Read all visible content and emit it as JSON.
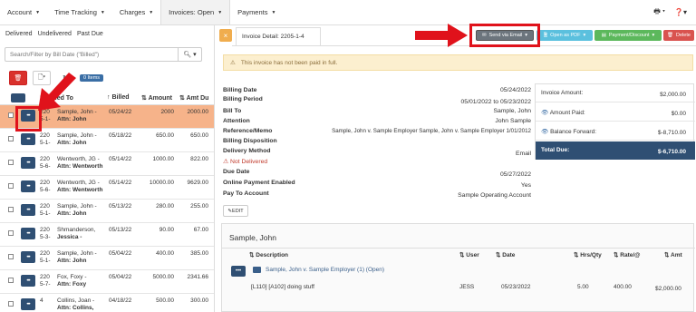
{
  "nav": {
    "items": [
      {
        "label": "Account"
      },
      {
        "label": "Time Tracking"
      },
      {
        "label": "Charges"
      },
      {
        "label": "Invoices: Open"
      },
      {
        "label": "Payments"
      }
    ]
  },
  "filters": {
    "links": [
      "Delivered",
      "Undelivered",
      "Past Due"
    ]
  },
  "search": {
    "placeholder": "Search/Filter by Bill Date (\"Billed\")"
  },
  "toolbar": {
    "items_badge": "0 Items"
  },
  "table": {
    "headers": {
      "bill_to": "Billed To",
      "billed": "Billed",
      "amount": "Amount",
      "amt_due": "Amt Du"
    },
    "rows": [
      {
        "num": "220 5-1-",
        "bill_to": "Sample, John -",
        "attn": "Attn: John",
        "date": "05/24/22",
        "amount": "2000",
        "due": "2000.00",
        "selected": true
      },
      {
        "num": "220 5-1-",
        "bill_to": "Sample, John -",
        "attn": "Attn: John",
        "date": "05/18/22",
        "amount": "650.00",
        "due": "650.00",
        "selected": false
      },
      {
        "num": "220 5-6-",
        "bill_to": "Wentworth, JG -",
        "attn": "Attn: Wentworth",
        "date": "05/14/22",
        "amount": "1000.00",
        "due": "822.00",
        "selected": false
      },
      {
        "num": "220 5-6-",
        "bill_to": "Wentworth, JG -",
        "attn": "Attn: Wentworth",
        "date": "05/14/22",
        "amount": "10000.00",
        "due": "9629.00",
        "selected": false
      },
      {
        "num": "220 5-1-",
        "bill_to": "Sample, John -",
        "attn": "Attn: John",
        "date": "05/13/22",
        "amount": "280.00",
        "due": "255.00",
        "selected": false
      },
      {
        "num": "220 5-3-",
        "bill_to": "Shmanderson,",
        "attn": "Jessica -",
        "date": "05/13/22",
        "amount": "90.00",
        "due": "67.00",
        "selected": false
      },
      {
        "num": "220 5-1-",
        "bill_to": "Sample, John -",
        "attn": "Attn: John",
        "date": "05/04/22",
        "amount": "400.00",
        "due": "385.00",
        "selected": false
      },
      {
        "num": "220 5-7-",
        "bill_to": "Fox, Foxy -",
        "attn": "Attn: Foxy",
        "date": "05/04/22",
        "amount": "5000.00",
        "due": "2341.66",
        "selected": false
      },
      {
        "num": "4",
        "bill_to": "Collins, Joan -",
        "attn": "Attn: Collins,",
        "date": "04/18/22",
        "amount": "500.00",
        "due": "300.00",
        "selected": false
      }
    ]
  },
  "detail": {
    "tab_label": "Invoice Detail: 2205-1-4",
    "buttons": {
      "email": "Send via Email",
      "pdf": "Open as PDF",
      "payment": "Payment/Discount",
      "delete": "Delete"
    },
    "warning": "This invoice has not been paid in full.",
    "fields": {
      "billing_date_k": "Billing Date",
      "billing_date_v": "05/24/2022",
      "billing_period_k": "Billing Period",
      "billing_period_v": "05/01/2022 to 05/23/2022",
      "bill_to_k": "Bill To",
      "bill_to_v": "Sample, John",
      "attention_k": "Attention",
      "attention_v": "John Sample",
      "ref_k": "Reference/Memo",
      "ref_v": "Sample, John v. Sample Employer Sample, John v. Sample Employer 1/01/2012",
      "disp_k": "Billing Disposition",
      "delivery_k": "Delivery Method",
      "delivery_v": "Email",
      "not_delivered": "Not Delivered",
      "due_k": "Due Date",
      "due_v": "05/27/2022",
      "online_k": "Online Payment Enabled",
      "online_v": "Yes",
      "pay_to_k": "Pay To Account",
      "pay_to_v": "Sample Operating Account"
    },
    "edit": "EDIT",
    "summary": {
      "invoice_amount_k": "Invoice Amount:",
      "invoice_amount_v": "$2,000.00",
      "amount_paid_k": "Amount Paid:",
      "amount_paid_v": "$0.00",
      "balance_k": "Balance Forward:",
      "balance_v": "$-8,710.00",
      "total_k": "Total Due:",
      "total_v": "$-6,710.00"
    },
    "panel": {
      "title": "Sample, John",
      "headers": {
        "description": "Description",
        "user": "User",
        "date": "Date",
        "hrs": "Hrs/Qty",
        "rate": "Rate/@",
        "amt": "Amt"
      },
      "matter": "Sample, John v. Sample Employer (1) (Open)",
      "line": {
        "description": "[L110] [A102] doing stuff",
        "user": "JESS",
        "date": "05/23/2022",
        "hrs": "5.00",
        "rate": "400.00",
        "amt": "$2,000.00"
      }
    }
  },
  "colors": {
    "accent": "#2f4f73",
    "highlight_row": "#f6b38a",
    "annotation": "#e0121b"
  }
}
